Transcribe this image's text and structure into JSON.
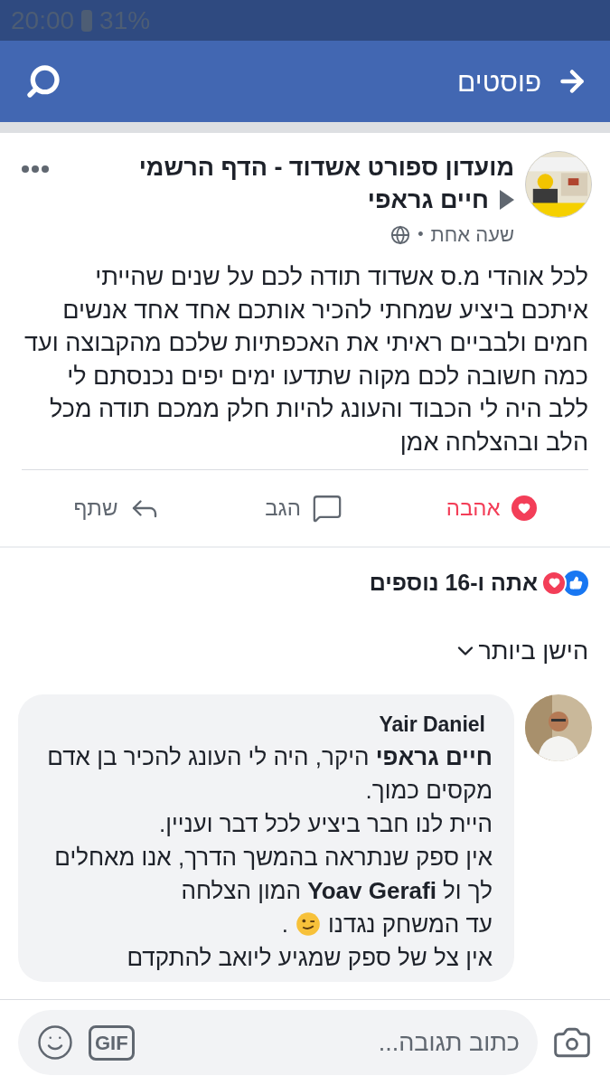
{
  "status_bar": {
    "time": "20:00",
    "battery": "31%"
  },
  "header": {
    "title": "פוסטים"
  },
  "post": {
    "page": "מועדון ספורט אשדוד - הדף הרשמי",
    "author": "חיים גראפי",
    "time": "שעה אחת",
    "separator": "•",
    "body": "לכל אוהדי מ.ס אשדוד תודה לכם על שנים שהייתי איתכם ביציע שמחתי להכיר אותכם אחד אחד אנשים חמים ולבביים ראיתי את האכפתיות שלכם מהקבוצה ועד כמה חשובה לכם מקוה שתדעו ימים יפים נכנסתם לי ללב היה לי הכבוד והעונג להיות חלק ממכם תודה מכל הלב ובהצלחה אמן"
  },
  "actions": [
    {
      "kind": "love",
      "label": "אהבה",
      "selected": true
    },
    {
      "kind": "comment",
      "label": "הגב",
      "selected": false
    },
    {
      "kind": "share",
      "label": "שתף",
      "selected": false
    }
  ],
  "reactions": {
    "summary": "אתה ו-16 נוספים"
  },
  "sort": {
    "label": "הישן ביותר"
  },
  "comment": {
    "author": "Yair Daniel",
    "lines": [
      "**חיים גראפי** היקר, היה לי העונג להכיר בן אדם מקסים כמוך.",
      "היית לנו חבר ביציע לכל דבר ועניין.",
      "אין ספק שנתראה בהמשך הדרך, אנו מאחלים לך ול **Yoav Gerafi** המון הצלחה"
    ],
    "emoji_line": {
      "text": "עד המשחק נגדנו",
      "after": "."
    },
    "last_line": "אין צל של ספק שמגיע ליואב להתקדם"
  },
  "composer": {
    "placeholder": "כתוב תגובה...",
    "gif": "GIF"
  }
}
